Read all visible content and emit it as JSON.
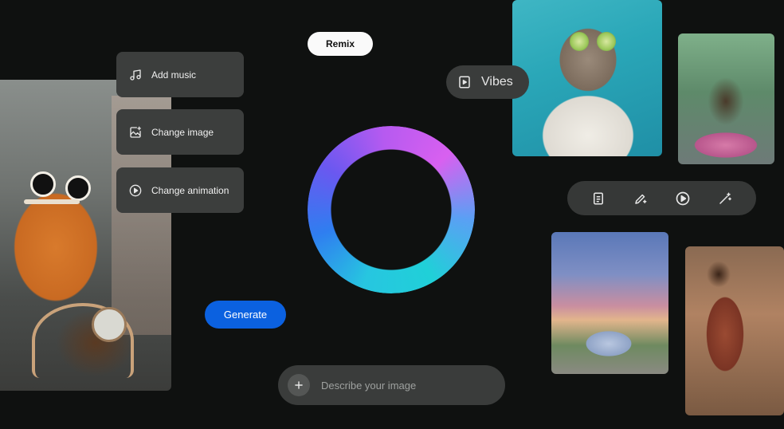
{
  "menu": {
    "items": [
      {
        "label": "Add music",
        "icon": "music-note-icon"
      },
      {
        "label": "Change image",
        "icon": "image-sparkle-icon"
      },
      {
        "label": "Change animation",
        "icon": "play-circle-icon"
      }
    ]
  },
  "remix": {
    "label": "Remix"
  },
  "vibes": {
    "label": "Vibes",
    "icon": "play-square-icon"
  },
  "generate": {
    "label": "Generate"
  },
  "prompt": {
    "placeholder": "Describe your image",
    "icon": "plus-icon"
  },
  "toolbar": {
    "icons": [
      "document-icon",
      "pen-sparkle-icon",
      "play-circle-icon",
      "magic-wand-icon"
    ]
  },
  "colors": {
    "background": "#0f1110",
    "accent_blue": "#0b61e0",
    "ring_gradient": [
      "#27c6e0",
      "#2f7ef0",
      "#6a58f0",
      "#b65af0",
      "#d860f0"
    ]
  }
}
